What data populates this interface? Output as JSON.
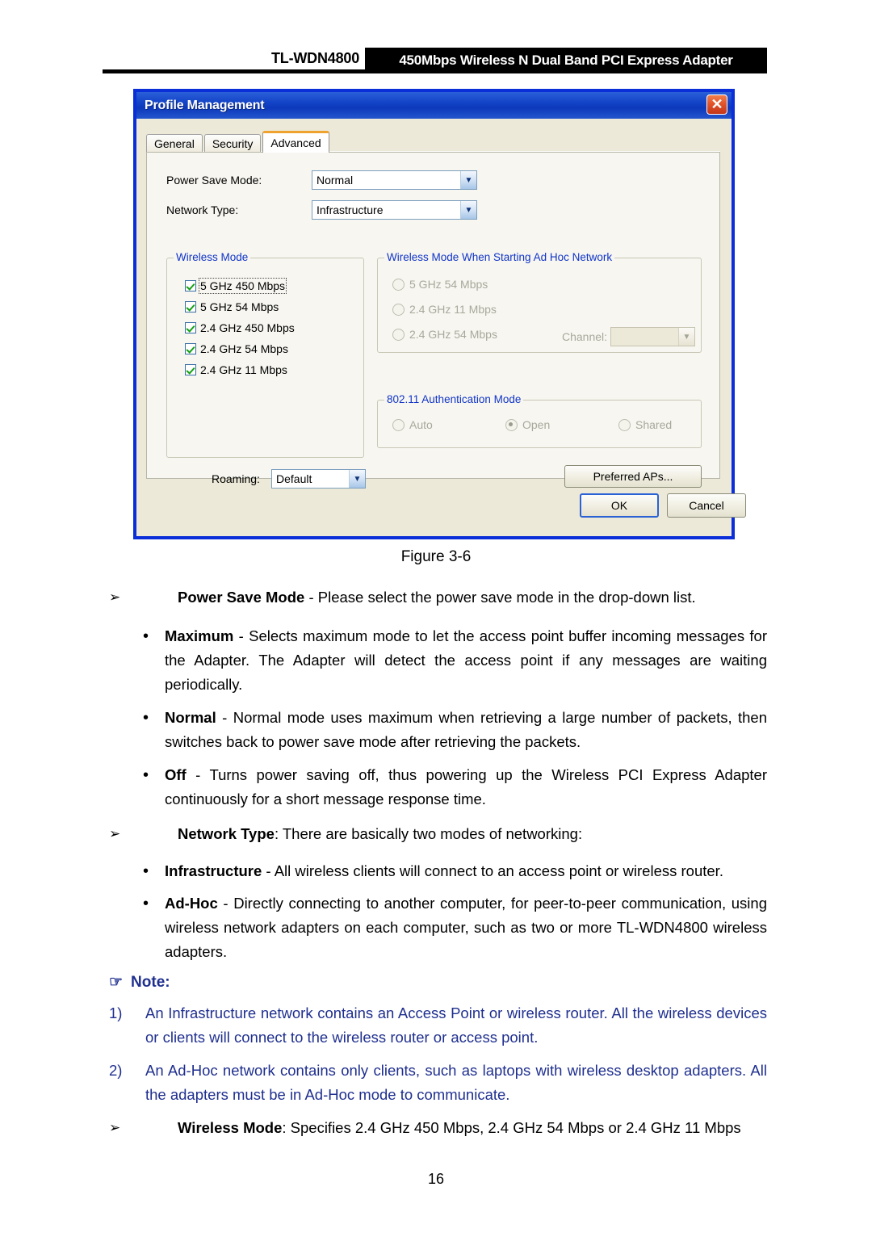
{
  "header": {
    "model": "TL-WDN4800",
    "product": "450Mbps Wireless N Dual Band PCI Express Adapter"
  },
  "dialog": {
    "title": "Profile Management",
    "close_label": "✕",
    "tabs": [
      {
        "label": "General",
        "active": false
      },
      {
        "label": "Security",
        "active": false
      },
      {
        "label": "Advanced",
        "active": true
      }
    ],
    "fields": [
      {
        "label": "Power Save Mode:",
        "value": "Normal"
      },
      {
        "label": "Network Type:",
        "value": "Infrastructure"
      }
    ],
    "wireless_mode": {
      "title": "Wireless Mode",
      "items": [
        {
          "label": "5 GHz 450 Mbps",
          "checked": true,
          "focused": true
        },
        {
          "label": "5 GHz 54 Mbps",
          "checked": true,
          "focused": false
        },
        {
          "label": "2.4 GHz 450 Mbps",
          "checked": true,
          "focused": false
        },
        {
          "label": "2.4 GHz 54 Mbps",
          "checked": true,
          "focused": false
        },
        {
          "label": "2.4 GHz 11 Mbps",
          "checked": true,
          "focused": false
        }
      ]
    },
    "adhoc": {
      "title": "Wireless Mode When Starting Ad Hoc Network",
      "items": [
        {
          "label": "5 GHz 54 Mbps",
          "checked": false
        },
        {
          "label": "2.4 GHz 11 Mbps",
          "checked": false
        },
        {
          "label": "2.4 GHz 54 Mbps",
          "checked": false
        }
      ],
      "channel_label": "Channel:",
      "channel_value": ""
    },
    "auth": {
      "title": "802.11 Authentication Mode",
      "items": [
        {
          "label": "Auto",
          "checked": false
        },
        {
          "label": "Open",
          "checked": true
        },
        {
          "label": "Shared",
          "checked": false
        }
      ]
    },
    "roaming": {
      "label": "Roaming:",
      "value": "Default"
    },
    "preferred_aps_label": "Preferred APs...",
    "ok_label": "OK",
    "cancel_label": "Cancel"
  },
  "figure_caption": "Figure 3-6",
  "body": {
    "power_save_mode": {
      "glyph": "➢",
      "bold": "Power Save Mode",
      "rest": " - Please select the power save mode in the drop-down list."
    },
    "bullets_power": [
      {
        "dot": "•",
        "bold": "Maximum",
        "rest": " - Selects maximum mode to let the access point buffer incoming messages for the Adapter. The Adapter will detect the access point if any messages are waiting periodically."
      },
      {
        "dot": "•",
        "bold": "Normal",
        "rest": " - Normal mode uses maximum when retrieving a large number of packets, then switches back to power save mode after retrieving the packets."
      },
      {
        "dot": "•",
        "bold": "Off",
        "rest": " - Turns power saving off, thus powering up the Wireless PCI Express Adapter continuously for a short message response time."
      }
    ],
    "network_type": {
      "glyph": "➢",
      "bold": "Network Type",
      "rest": ": There are basically two modes of networking:"
    },
    "bullets_network": [
      {
        "dot": "•",
        "bold": "Infrastructure",
        "rest": " - All wireless clients will connect to an access point or wireless router."
      },
      {
        "dot": "•",
        "bold": "Ad-Hoc",
        "rest": " - Directly connecting to another computer, for peer-to-peer communication, using wireless network adapters on each computer, such as two or more TL-WDN4800 wireless adapters."
      }
    ],
    "note": {
      "hand": "☞",
      "title": "Note:",
      "items": [
        {
          "num": "1)",
          "text": "An Infrastructure network contains an Access Point or wireless router. All the wireless devices or clients will connect to the wireless router or access point."
        },
        {
          "num": "2)",
          "text": "An Ad-Hoc network contains only clients, such as laptops with wireless desktop adapters. All the adapters must be in Ad-Hoc mode to communicate."
        }
      ]
    },
    "wireless_mode_line": {
      "glyph": "➢",
      "bold": "Wireless Mode",
      "rest": ": Specifies 2.4 GHz 450 Mbps, 2.4 GHz 54 Mbps or 2.4 GHz 11 Mbps"
    },
    "page_number": "16"
  }
}
